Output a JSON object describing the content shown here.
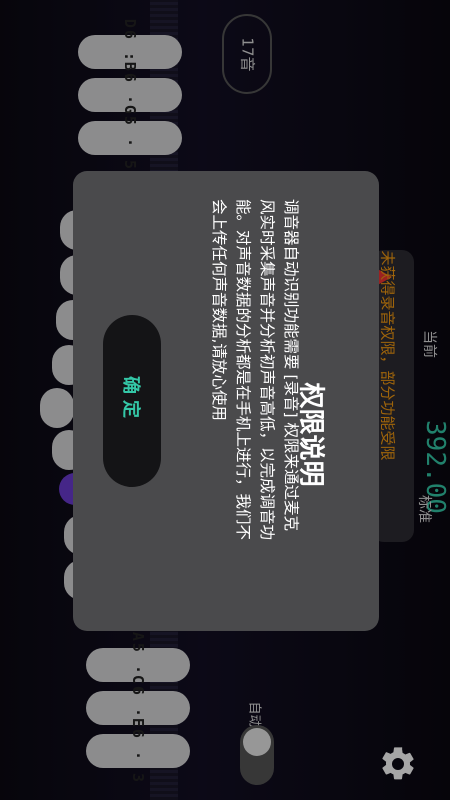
{
  "keys": [
    {
      "label": "D6 : 2"
    },
    {
      "label": "B6 · 7"
    },
    {
      "label": "G5 · 5"
    },
    {
      "label": "A5 · 6"
    },
    {
      "label": "C6 · 1"
    },
    {
      "label": "E6 · 3"
    }
  ],
  "voices": "17音",
  "warning": "未获得录音权限，部分功能受限",
  "current": {
    "label": "当前",
    "value": "392.00",
    "unit": "标准"
  },
  "auto_label": "自动",
  "modal": {
    "title": "权限说明",
    "lines": [
      "调音器自动识别功能需要 [录音] 权限来通过麦克",
      "风实时采集声音并分析初声音高低，以完成调音功",
      "能。对声音数据的分析都是在手机上进行，我们不",
      "会上传任何声音数据,请放心使用"
    ],
    "confirm": "确定"
  },
  "colors": {
    "accent": "#34c7a7",
    "warning": "#f39a11",
    "modal_bg": "#4a4a4c",
    "knob_purple": "#6a3bd1"
  }
}
